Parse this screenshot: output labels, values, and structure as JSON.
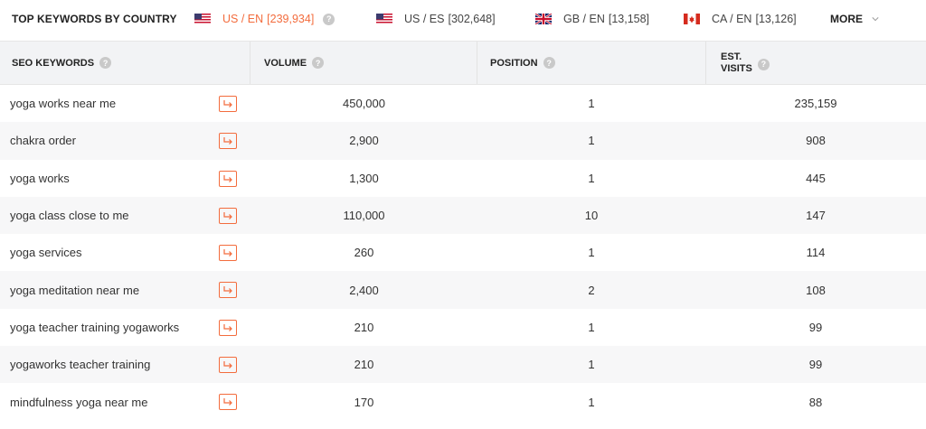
{
  "header": {
    "title": "TOP KEYWORDS BY COUNTRY",
    "more_label": "MORE"
  },
  "countries": [
    {
      "label": "US / EN",
      "count": "[239,934]",
      "flag": "us-flag-icon",
      "active": true
    },
    {
      "label": "US / ES",
      "count": "[302,648]",
      "flag": "us-flag-icon",
      "active": false
    },
    {
      "label": "GB / EN",
      "count": "[13,158]",
      "flag": "gb-flag-icon",
      "active": false
    },
    {
      "label": "CA / EN",
      "count": "[13,126]",
      "flag": "ca-flag-icon",
      "active": false
    }
  ],
  "columns": {
    "keywords": "SEO KEYWORDS",
    "volume": "VOLUME",
    "position": "POSITION",
    "visits_line1": "EST.",
    "visits_line2": "VISITS"
  },
  "rows": [
    {
      "keyword": "yoga works near me",
      "volume": "450,000",
      "position": "1",
      "visits": "235,159"
    },
    {
      "keyword": "chakra order",
      "volume": "2,900",
      "position": "1",
      "visits": "908"
    },
    {
      "keyword": "yoga works",
      "volume": "1,300",
      "position": "1",
      "visits": "445"
    },
    {
      "keyword": "yoga class close to me",
      "volume": "110,000",
      "position": "10",
      "visits": "147"
    },
    {
      "keyword": "yoga services",
      "volume": "260",
      "position": "1",
      "visits": "114"
    },
    {
      "keyword": "yoga meditation near me",
      "volume": "2,400",
      "position": "2",
      "visits": "108"
    },
    {
      "keyword": "yoga teacher training yogaworks",
      "volume": "210",
      "position": "1",
      "visits": "99"
    },
    {
      "keyword": "yogaworks teacher training",
      "volume": "210",
      "position": "1",
      "visits": "99"
    },
    {
      "keyword": "mindfulness yoga near me",
      "volume": "170",
      "position": "1",
      "visits": "88"
    }
  ],
  "colors": {
    "accent": "#f36c3d",
    "header_bg": "#f2f3f5",
    "alt_row_bg": "#f7f7f8"
  }
}
